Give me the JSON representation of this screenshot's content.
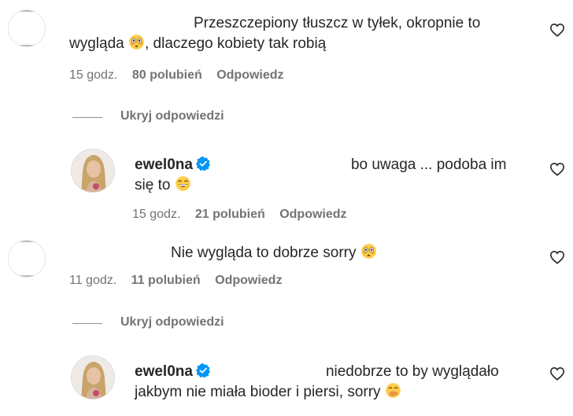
{
  "comments": [
    {
      "text": "Przeszczepiony tłuszcz w tyłek, okropnie to",
      "text2": "wygląda",
      "text3": ", dlaczego kobiety tak robią",
      "time": "15 godz.",
      "likes": "80 polubień",
      "reply": "Odpowiedz"
    },
    {
      "username": "ewel0na",
      "text": "bo uwaga ... podoba im",
      "text2": "się to",
      "time": "15 godz.",
      "likes": "21 polubień",
      "reply": "Odpowiedz"
    },
    {
      "text": "Nie wygląda to dobrze sorry",
      "time": "11 godz.",
      "likes": "11 polubień",
      "reply": "Odpowiedz"
    },
    {
      "username": "ewel0na",
      "text": "niedobrze to by wyglądało",
      "text2": "jakbym nie miała bioder i piersi, sorry"
    }
  ],
  "hide_replies_label": "Ukryj odpowiedzi",
  "colors": {
    "text": "#262626",
    "meta": "#737373",
    "verified": "#0095f6"
  },
  "icons": [
    "heart-icon",
    "verified-badge-icon",
    "flushed-face-emoji",
    "grinning-face-emoji",
    "hand-over-mouth-emoji"
  ]
}
